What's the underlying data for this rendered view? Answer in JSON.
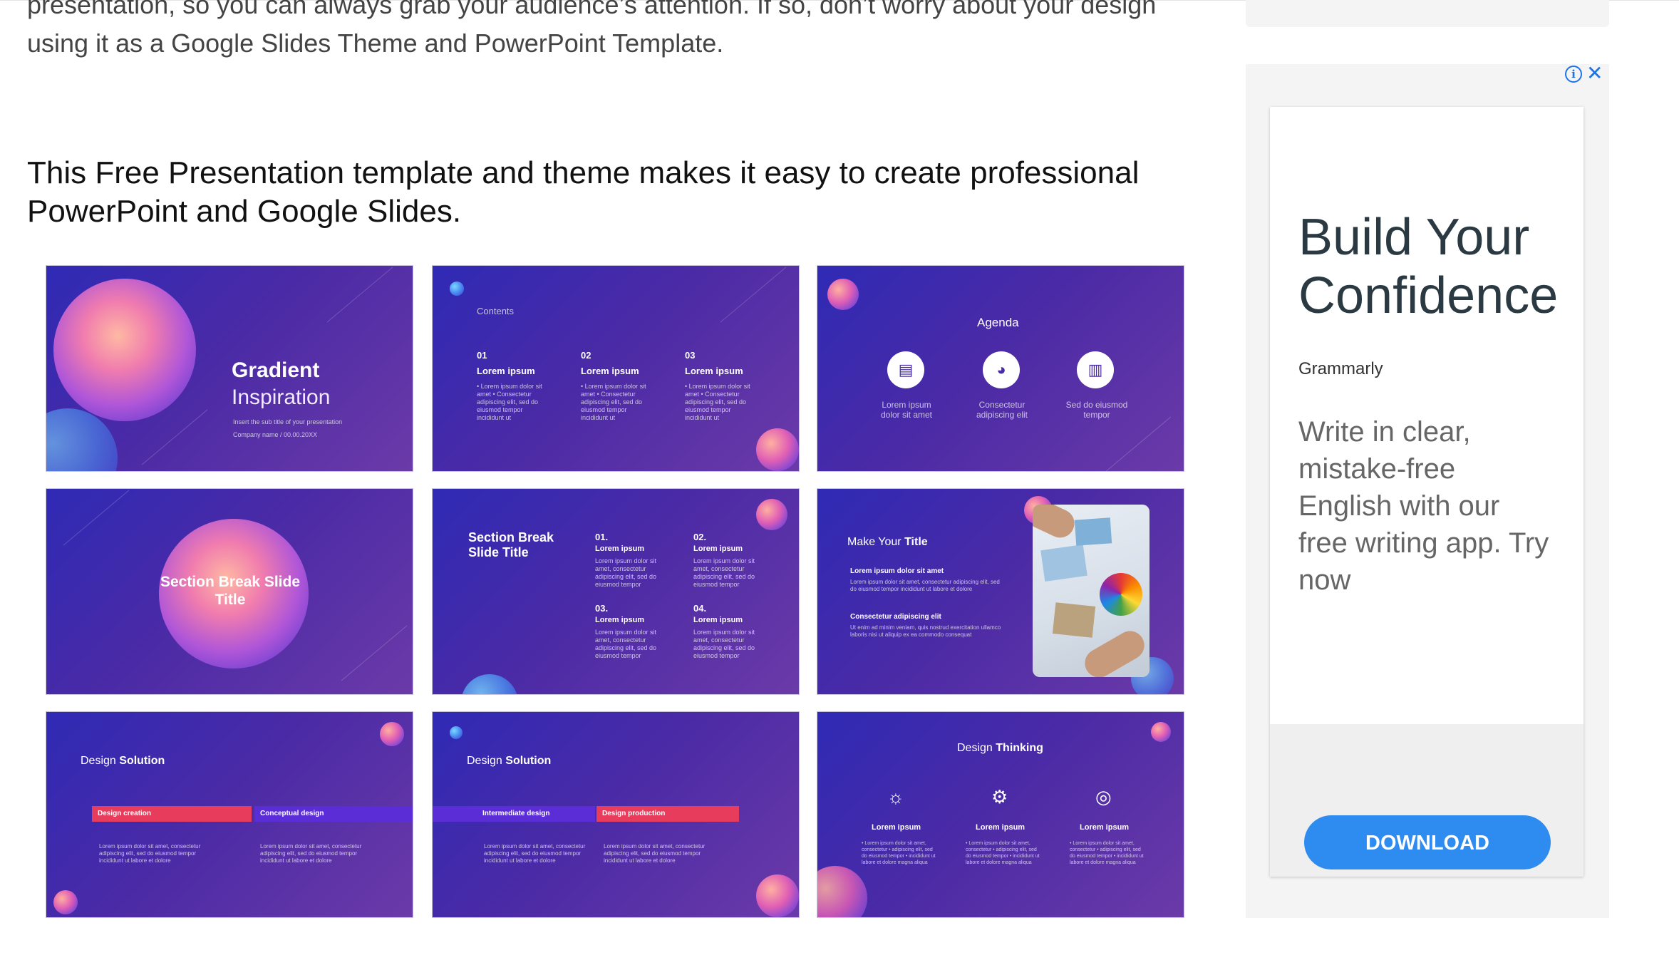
{
  "article": {
    "intro": "presentation, so you can always grab your audience’s attention. If so, don’t worry about your design using it as a Google Slides Theme and PowerPoint Template.",
    "heading": "This Free Presentation template and theme makes it easy to create professional PowerPoint and Google Slides."
  },
  "slides": {
    "s1": {
      "title": "Gradient",
      "subtitle": "Inspiration",
      "line1": "Insert the sub title of your presentation",
      "line2": "Company name  /  00.00.20XX"
    },
    "s2": {
      "heading": "Contents",
      "cols": [
        {
          "num": "01",
          "title": "Lorem ipsum",
          "text": "• Lorem ipsum dolor sit amet • Consectetur adipiscing elit, sed do eiusmod tempor incididunt ut"
        },
        {
          "num": "02",
          "title": "Lorem ipsum",
          "text": "• Lorem ipsum dolor sit amet • Consectetur adipiscing elit, sed do eiusmod tempor incididunt ut"
        },
        {
          "num": "03",
          "title": "Lorem ipsum",
          "text": "• Lorem ipsum dolor sit amet • Consectetur adipiscing elit, sed do eiusmod tempor incididunt ut"
        }
      ]
    },
    "s3": {
      "heading": "Agenda",
      "items": [
        {
          "icon": "clipboard-icon",
          "label": "Lorem ipsum dolor sit amet"
        },
        {
          "icon": "pie-chart-icon",
          "label": "Consectetur adipiscing elit"
        },
        {
          "icon": "bar-chart-icon",
          "label": "Sed do eiusmod tempor"
        }
      ]
    },
    "s4": {
      "title": "Section Break Slide Title"
    },
    "s5": {
      "title": "Section Break Slide Title",
      "items": [
        {
          "num": "01.",
          "title": "Lorem ipsum",
          "text": "Lorem ipsum dolor sit amet, consectetur adipiscing elit, sed do eiusmod tempor"
        },
        {
          "num": "02.",
          "title": "Lorem ipsum",
          "text": "Lorem ipsum dolor sit amet, consectetur adipiscing elit, sed do eiusmod tempor"
        },
        {
          "num": "03.",
          "title": "Lorem ipsum",
          "text": "Lorem ipsum dolor sit amet, consectetur adipiscing elit, sed do eiusmod tempor"
        },
        {
          "num": "04.",
          "title": "Lorem ipsum",
          "text": "Lorem ipsum dolor sit amet, consectetur adipiscing elit, sed do eiusmod tempor"
        }
      ]
    },
    "s6": {
      "title_light": "Make Your",
      "title_bold": "Title",
      "h1": "Lorem ipsum dolor sit amet",
      "p1": "Lorem ipsum dolor sit amet, consectetur adipiscing elit, sed do eiusmod tempor incididunt ut labore et dolore",
      "h2": "Consectetur adipiscing elit",
      "p2": "Ut enim ad minim veniam, quis nostrud exercitation ullamco laboris nisi ut aliquip ex ea commodo consequat"
    },
    "s7": {
      "title_light": "Design",
      "title_bold": "Solution",
      "bar1": "Design creation",
      "bar2": "Conceptual design",
      "text1": "Lorem ipsum dolor sit amet, consectetur adipiscing elit, sed do eiusmod tempor incididunt ut labore et dolore",
      "text2": "Lorem ipsum dolor sit amet, consectetur adipiscing elit, sed do eiusmod tempor incididunt ut labore et dolore"
    },
    "s8": {
      "title_light": "Design",
      "title_bold": "Solution",
      "bar1": "Intermediate design",
      "bar2": "Design production",
      "text1": "Lorem ipsum dolor sit amet, consectetur adipiscing elit, sed do eiusmod tempor incididunt ut labore et dolore",
      "text2": "Lorem ipsum dolor sit amet, consectetur adipiscing elit, sed do eiusmod tempor incididunt ut labore et dolore"
    },
    "s9": {
      "title_light": "Design",
      "title_bold": "Thinking",
      "items": [
        {
          "icon": "lightbulb-icon",
          "title": "Lorem ipsum",
          "text": "• Lorem ipsum dolor sit amet, consectetur • adipiscing elit, sed do eiusmod tempor • incididunt ut labore et dolore magna aliqua"
        },
        {
          "icon": "gear-icon",
          "title": "Lorem ipsum",
          "text": "• Lorem ipsum dolor sit amet, consectetur • adipiscing elit, sed do eiusmod tempor • incididunt ut labore et dolore magna aliqua"
        },
        {
          "icon": "target-icon",
          "title": "Lorem ipsum",
          "text": "• Lorem ipsum dolor sit amet, consectetur • adipiscing elit, sed do eiusmod tempor • incididunt ut labore et dolore magna aliqua"
        }
      ]
    }
  },
  "ad": {
    "headline": "Build Your Confidence",
    "brand": "Grammarly",
    "body": "Write in clear, mistake-free English with our free writing app. Try now",
    "button": "DOWNLOAD",
    "info_glyph": "i",
    "close_glyph": "✕",
    "button_color": "#2e8cf0",
    "info_color": "#1a73e8"
  }
}
